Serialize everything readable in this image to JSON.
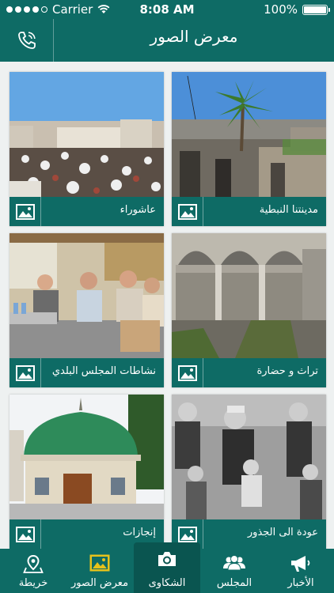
{
  "status_bar": {
    "carrier": "Carrier",
    "time": "8:08 AM",
    "battery": "100%",
    "battery_level": 1.0
  },
  "header": {
    "title": "معرض الصور"
  },
  "gallery": {
    "items": [
      {
        "label": "مدينتنا النبطية"
      },
      {
        "label": "عاشوراء"
      },
      {
        "label": "تراث و حضارة"
      },
      {
        "label": "نشاطات المجلس البلدي"
      },
      {
        "label": "عودة الى الجذور"
      },
      {
        "label": "إنجازات"
      }
    ]
  },
  "tabs": [
    {
      "label": "خريطة",
      "icon": "map-pin-icon"
    },
    {
      "label": "معرض الصور",
      "icon": "gallery-icon"
    },
    {
      "label": "الشكاوى",
      "icon": "camera-icon"
    },
    {
      "label": "المجلس",
      "icon": "group-icon"
    },
    {
      "label": "الأخبار",
      "icon": "megaphone-icon"
    }
  ],
  "colors": {
    "primary": "#0e6b65",
    "active_tab": "#0a5550",
    "gallery_icon_accent": "#e6c21b"
  }
}
